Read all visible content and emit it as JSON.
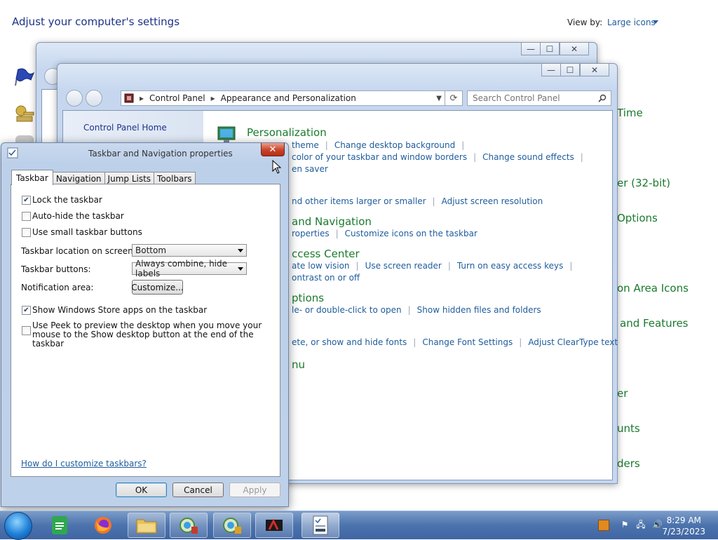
{
  "background_panel": {
    "title": "Adjust your computer's settings",
    "view_by_label": "View by:",
    "view_by_value": "Large icons",
    "items_visible": [
      "Time",
      "er (32-bit)",
      "Options",
      "on Area Icons",
      "and Features",
      "er",
      "unts",
      "ders"
    ]
  },
  "back_window": {
    "buttons": {
      "minimize": "—",
      "maximize": "☐",
      "close": "✕"
    }
  },
  "control_panel": {
    "address": {
      "segment1": "Control Panel",
      "segment2": "Appearance and Personalization"
    },
    "search_placeholder": "Search Control Panel",
    "sidebar": {
      "home_link": "Control Panel Home"
    },
    "sections": {
      "personalization": {
        "heading": "Personalization",
        "links": [
          "theme",
          "Change desktop background",
          "color of your taskbar and window borders",
          "Change sound effects",
          "en saver"
        ]
      },
      "display": {
        "links": [
          "nd other items larger or smaller",
          "Adjust screen resolution"
        ]
      },
      "taskbar_nav": {
        "heading": "and Navigation",
        "links": [
          "roperties",
          "Customize icons on the taskbar"
        ]
      },
      "ease_access": {
        "heading": "ccess Center",
        "links": [
          "ate low vision",
          "Use screen reader",
          "Turn on easy access keys",
          "ontrast on or off"
        ]
      },
      "folder_options": {
        "heading": "ptions",
        "links": [
          "le- or double-click to open",
          "Show hidden files and folders"
        ]
      },
      "fonts": {
        "links": [
          "ete, or show and hide fonts",
          "Change Font Settings",
          "Adjust ClearType text"
        ]
      },
      "nu": {
        "heading": "nu"
      }
    }
  },
  "dialog": {
    "title": "Taskbar and Navigation properties",
    "close_glyph": "✕",
    "tabs": [
      "Taskbar",
      "Navigation",
      "Jump Lists",
      "Toolbars"
    ],
    "options": {
      "lock": {
        "label": "Lock the taskbar",
        "checked": true
      },
      "autohide": {
        "label": "Auto-hide the taskbar",
        "checked": false
      },
      "small": {
        "label": "Use small taskbar buttons",
        "checked": false
      },
      "store": {
        "label": "Show Windows Store apps on the taskbar",
        "checked": true
      },
      "peek": {
        "label": "Use Peek to preview the desktop when you move your mouse to the Show desktop button at the end of the taskbar",
        "checked": false
      }
    },
    "location_label": "Taskbar location on screen:",
    "location_value": "Bottom",
    "buttons_label": "Taskbar buttons:",
    "buttons_value": "Always combine, hide labels",
    "notification_label": "Notification area:",
    "customize_button": "Customize...",
    "help_link": "How do I customize taskbars?",
    "ok": "OK",
    "cancel": "Cancel",
    "apply": "Apply"
  },
  "taskbar": {
    "apps": [
      "start-orb",
      "google-sheets-icon",
      "firefox-icon",
      "file-explorer-icon",
      "control-panel-icon",
      "control-panel-icon-2",
      "media-app-icon",
      "taskbar-properties-icon"
    ],
    "clock_time": "8:29 AM",
    "clock_date": "7/23/2023"
  },
  "colors": {
    "accent": "#1e5c9c",
    "heading_green": "#1a7a2e",
    "taskbar": "#4c73ad"
  }
}
